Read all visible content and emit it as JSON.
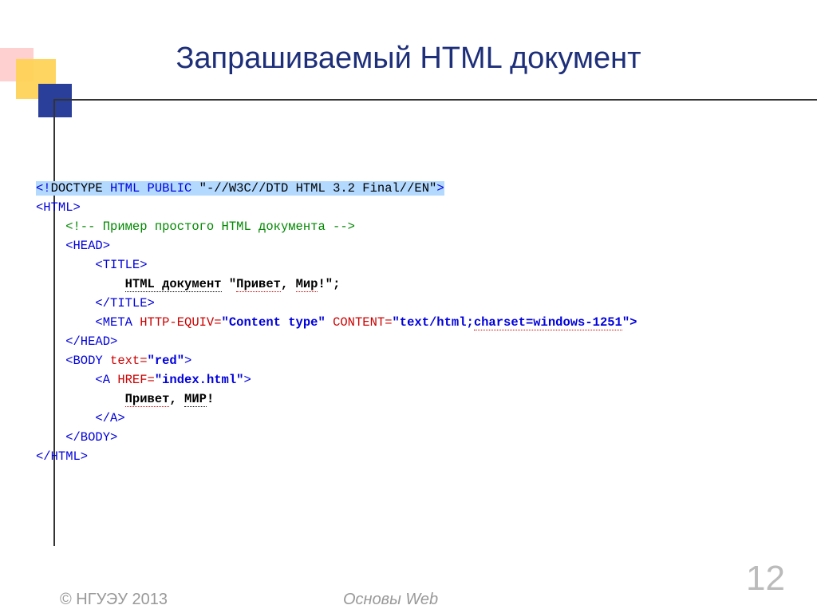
{
  "title": "Запрашиваемый HTML документ",
  "code": {
    "l1a": "<!",
    "l1b": "DOCTYPE",
    "l1c": " HTML PUBLIC ",
    "l1d": "\"-//W3C//DTD HTML 3.2 Final//EN\"",
    "l1e": ">",
    "l2": "<HTML>",
    "l3": "    <!-- Пример простого HTML документа -->",
    "l4": "    <HEAD>",
    "l5": "        <TITLE>",
    "l6a": "            ",
    "l6b": "HTML документ",
    "l6c": " \"",
    "l6d": "Привет",
    "l6e": ", ",
    "l6f": "Мир",
    "l6g": "!\";",
    "l7": "        </TITLE>",
    "l8a": "        <META",
    "l8b": " HTTP-EQUIV=",
    "l8c": "\"Content type\"",
    "l8d": " CONTENT=",
    "l8e": "\"text/html;",
    "l8f": "charset=windows-1251",
    "l8g": "\">",
    "l9": "    </HEAD>",
    "l10a": "    <BODY",
    "l10b": " text=",
    "l10c": "\"red\"",
    "l10d": ">",
    "l11a": "        <A",
    "l11b": " HREF=",
    "l11c": "\"index.html\"",
    "l11d": ">",
    "l12a": "            ",
    "l12b": "Привет",
    "l12c": ", ",
    "l12d": "МИР",
    "l12e": "!",
    "l13": "        </A>",
    "l14": "    </BODY>",
    "l15": "</HTML>"
  },
  "footer": {
    "copyright": "© НГУЭУ 2013",
    "subject": "Основы Web",
    "page": "12"
  }
}
